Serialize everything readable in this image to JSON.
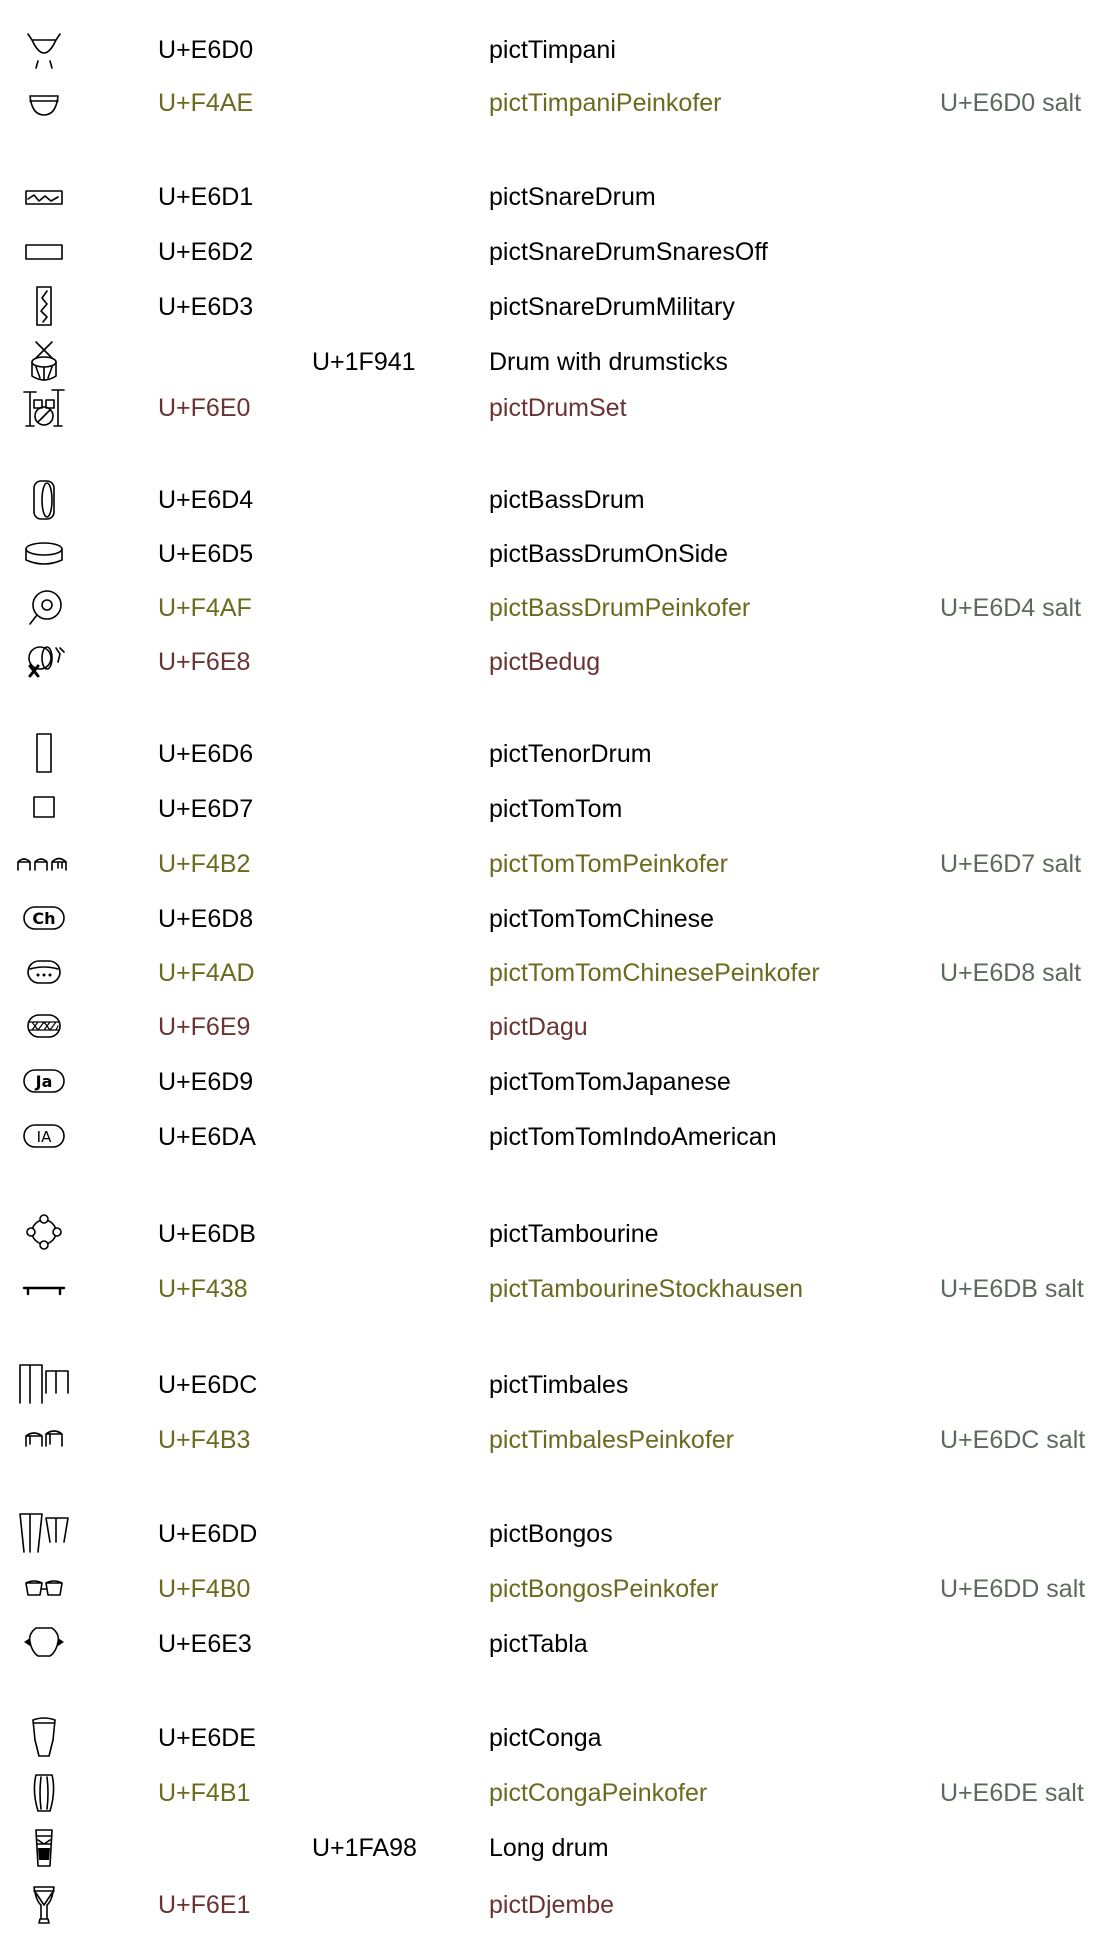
{
  "rows": [
    {
      "smufl": "U+E6D0",
      "unicode": "",
      "name": "pictTimpani",
      "alt": ""
    },
    {
      "smufl": "U+F4AE",
      "unicode": "",
      "name": "pictTimpaniPeinkofer",
      "alt": "U+E6D0 salt"
    },
    {
      "smufl": "U+E6D1",
      "unicode": "",
      "name": "pictSnareDrum",
      "alt": ""
    },
    {
      "smufl": "U+E6D2",
      "unicode": "",
      "name": "pictSnareDrumSnaresOff",
      "alt": ""
    },
    {
      "smufl": "U+E6D3",
      "unicode": "",
      "name": "pictSnareDrumMilitary",
      "alt": ""
    },
    {
      "smufl": "",
      "unicode": "U+1F941",
      "name": "Drum with drumsticks",
      "alt": ""
    },
    {
      "smufl": "U+F6E0",
      "unicode": "",
      "name": "pictDrumSet",
      "alt": ""
    },
    {
      "smufl": "U+E6D4",
      "unicode": "",
      "name": "pictBassDrum",
      "alt": ""
    },
    {
      "smufl": "U+E6D5",
      "unicode": "",
      "name": "pictBassDrumOnSide",
      "alt": ""
    },
    {
      "smufl": "U+F4AF",
      "unicode": "",
      "name": "pictBassDrumPeinkofer",
      "alt": "U+E6D4 salt"
    },
    {
      "smufl": "U+F6E8",
      "unicode": "",
      "name": "pictBedug",
      "alt": ""
    },
    {
      "smufl": "U+E6D6",
      "unicode": "",
      "name": "pictTenorDrum",
      "alt": ""
    },
    {
      "smufl": "U+E6D7",
      "unicode": "",
      "name": "pictTomTom",
      "alt": ""
    },
    {
      "smufl": "U+F4B2",
      "unicode": "",
      "name": "pictTomTomPeinkofer",
      "alt": "U+E6D7 salt"
    },
    {
      "smufl": "U+E6D8",
      "unicode": "",
      "name": "pictTomTomChinese",
      "alt": ""
    },
    {
      "smufl": "U+F4AD",
      "unicode": "",
      "name": "pictTomTomChinesePeinkofer",
      "alt": "U+E6D8 salt"
    },
    {
      "smufl": "U+F6E9",
      "unicode": "",
      "name": "pictDagu",
      "alt": ""
    },
    {
      "smufl": "U+E6D9",
      "unicode": "",
      "name": "pictTomTomJapanese",
      "alt": ""
    },
    {
      "smufl": "U+E6DA",
      "unicode": "",
      "name": "pictTomTomIndoAmerican",
      "alt": ""
    },
    {
      "smufl": "U+E6DB",
      "unicode": "",
      "name": "pictTambourine",
      "alt": ""
    },
    {
      "smufl": "U+F438",
      "unicode": "",
      "name": "pictTambourineStockhausen",
      "alt": "U+E6DB salt"
    },
    {
      "smufl": "U+E6DC",
      "unicode": "",
      "name": "pictTimbales",
      "alt": ""
    },
    {
      "smufl": "U+F4B3",
      "unicode": "",
      "name": "pictTimbalesPeinkofer",
      "alt": "U+E6DC salt"
    },
    {
      "smufl": "U+E6DD",
      "unicode": "",
      "name": "pictBongos",
      "alt": ""
    },
    {
      "smufl": "U+F4B0",
      "unicode": "",
      "name": "pictBongosPeinkofer",
      "alt": "U+E6DD salt"
    },
    {
      "smufl": "U+E6E3",
      "unicode": "",
      "name": "pictTabla",
      "alt": ""
    },
    {
      "smufl": "U+E6DE",
      "unicode": "",
      "name": "pictConga",
      "alt": ""
    },
    {
      "smufl": "U+F4B1",
      "unicode": "",
      "name": "pictCongaPeinkofer",
      "alt": "U+E6DE salt"
    },
    {
      "smufl": "",
      "unicode": "U+1FA98",
      "name": "Long drum",
      "alt": ""
    },
    {
      "smufl": "U+F6E1",
      "unicode": "",
      "name": "pictDjembe",
      "alt": ""
    }
  ],
  "colors": {
    "recommended": "#6b6a1f",
    "optional": "#6a3434",
    "alt": "#5c6a5c",
    "text": "#000000"
  },
  "icon_names": [
    "timpani-icon",
    "timpani-peinkofer-icon",
    "snare-drum-icon",
    "snare-drum-snares-off-icon",
    "snare-drum-military-icon",
    "drum-with-drumsticks-icon",
    "drum-set-icon",
    "bass-drum-icon",
    "bass-drum-on-side-icon",
    "bass-drum-peinkofer-icon",
    "bedug-icon",
    "tenor-drum-icon",
    "tom-tom-icon",
    "tom-tom-peinkofer-icon",
    "tom-tom-chinese-icon",
    "tom-tom-chinese-peinkofer-icon",
    "dagu-icon",
    "tom-tom-japanese-icon",
    "tom-tom-indo-american-icon",
    "tambourine-icon",
    "tambourine-stockhausen-icon",
    "timbales-icon",
    "timbales-peinkofer-icon",
    "bongos-icon",
    "bongos-peinkofer-icon",
    "tabla-icon",
    "conga-icon",
    "conga-peinkofer-icon",
    "long-drum-icon",
    "djembe-icon"
  ]
}
